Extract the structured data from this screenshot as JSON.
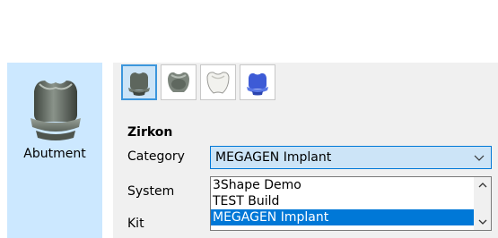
{
  "left_tile": {
    "label": "Abutment",
    "icon": "abutment-icon"
  },
  "thumbnails": [
    {
      "icon": "abutment-thumb-icon",
      "selected": true
    },
    {
      "icon": "crown-gray-thumb-icon",
      "selected": false
    },
    {
      "icon": "crown-white-thumb-icon",
      "selected": false
    },
    {
      "icon": "crown-blue-thumb-icon",
      "selected": false
    }
  ],
  "section": {
    "title": "Zirkon"
  },
  "fields": {
    "category_label": "Category",
    "system_label": "System",
    "kit_label": "Kit"
  },
  "category_combo": {
    "value": "MEGAGEN Implant",
    "options": [
      "3Shape Demo",
      "TEST  Build",
      "MEGAGEN Implant"
    ],
    "selected_index": 2
  },
  "colors": {
    "tile_bg": "#cce8ff",
    "panel_bg": "#f0f0f0",
    "accent": "#0078d7",
    "combo_bg": "#cce4f7"
  }
}
